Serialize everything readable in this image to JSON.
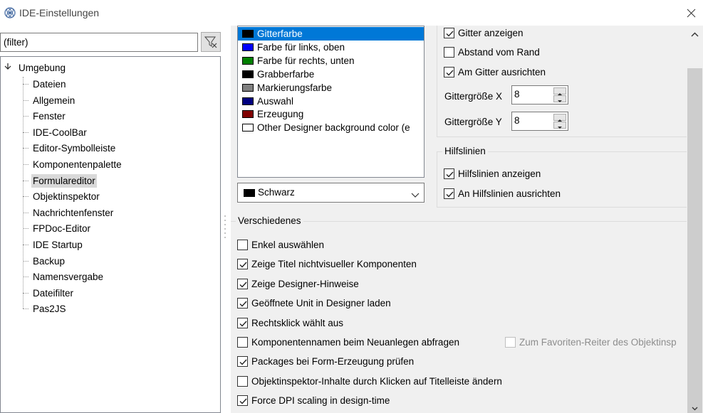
{
  "window": {
    "title": "IDE-Einstellungen"
  },
  "filter": {
    "value": "(filter)"
  },
  "tree": {
    "root": "Umgebung",
    "items": [
      "Dateien",
      "Allgemein",
      "Fenster",
      "IDE-CoolBar",
      "Editor-Symbolleiste",
      "Komponentenpalette",
      "Formulareditor",
      "Objektinspektor",
      "Nachrichtenfenster",
      "FPDoc-Editor",
      "IDE Startup",
      "Backup",
      "Namensvergabe",
      "Dateifilter",
      "Pas2JS"
    ],
    "selected": "Formulareditor"
  },
  "colors": {
    "items": [
      {
        "label": "Gitterfarbe",
        "swatch": "#000000"
      },
      {
        "label": "Farbe für links, oben",
        "swatch": "#0000ff"
      },
      {
        "label": "Farbe für rechts, unten",
        "swatch": "#008000"
      },
      {
        "label": "Grabberfarbe",
        "swatch": "#000000"
      },
      {
        "label": "Markierungsfarbe",
        "swatch": "#808080"
      },
      {
        "label": "Auswahl",
        "swatch": "#000080"
      },
      {
        "label": "Erzeugung",
        "swatch": "#800000"
      },
      {
        "label": "Other Designer background color (e",
        "swatch": "#ffffff"
      }
    ],
    "selected": "Gitterfarbe",
    "combo_value": "Schwarz",
    "combo_swatch": "#000000"
  },
  "grid": {
    "show_grid": {
      "label": "Gitter anzeigen",
      "checked": true
    },
    "border_spacing": {
      "label": "Abstand vom Rand",
      "checked": false
    },
    "snap_to_grid": {
      "label": "Am Gitter ausrichten",
      "checked": true
    },
    "size_x_label": "Gittergröße X",
    "size_x_value": "8",
    "size_y_label": "Gittergröße Y",
    "size_y_value": "8"
  },
  "guides": {
    "title": "Hilfslinien",
    "show_guides": {
      "label": "Hilfslinien anzeigen",
      "checked": true
    },
    "snap_to_guides": {
      "label": "An Hilfslinien ausrichten",
      "checked": true
    }
  },
  "misc": {
    "title": "Verschiedenes",
    "options": [
      {
        "label": "Enkel auswählen",
        "checked": false
      },
      {
        "label": "Zeige Titel nichtvisueller Komponenten",
        "checked": true
      },
      {
        "label": "Zeige Designer-Hinweise",
        "checked": true
      },
      {
        "label": "Geöffnete Unit in Designer laden",
        "checked": true
      },
      {
        "label": "Rechtsklick wählt aus",
        "checked": true
      },
      {
        "label": "Komponentennamen beim Neuanlegen abfragen",
        "checked": false
      },
      {
        "label": "Packages bei Form-Erzeugung prüfen",
        "checked": true
      },
      {
        "label": "Objektinspektor-Inhalte durch Klicken auf Titelleiste ändern",
        "checked": false
      },
      {
        "label": "Force DPI scaling in design-time",
        "checked": true
      }
    ],
    "favorites": {
      "label": "Zum Favoriten-Reiter des Objektinsp",
      "checked": false,
      "disabled": true
    }
  }
}
